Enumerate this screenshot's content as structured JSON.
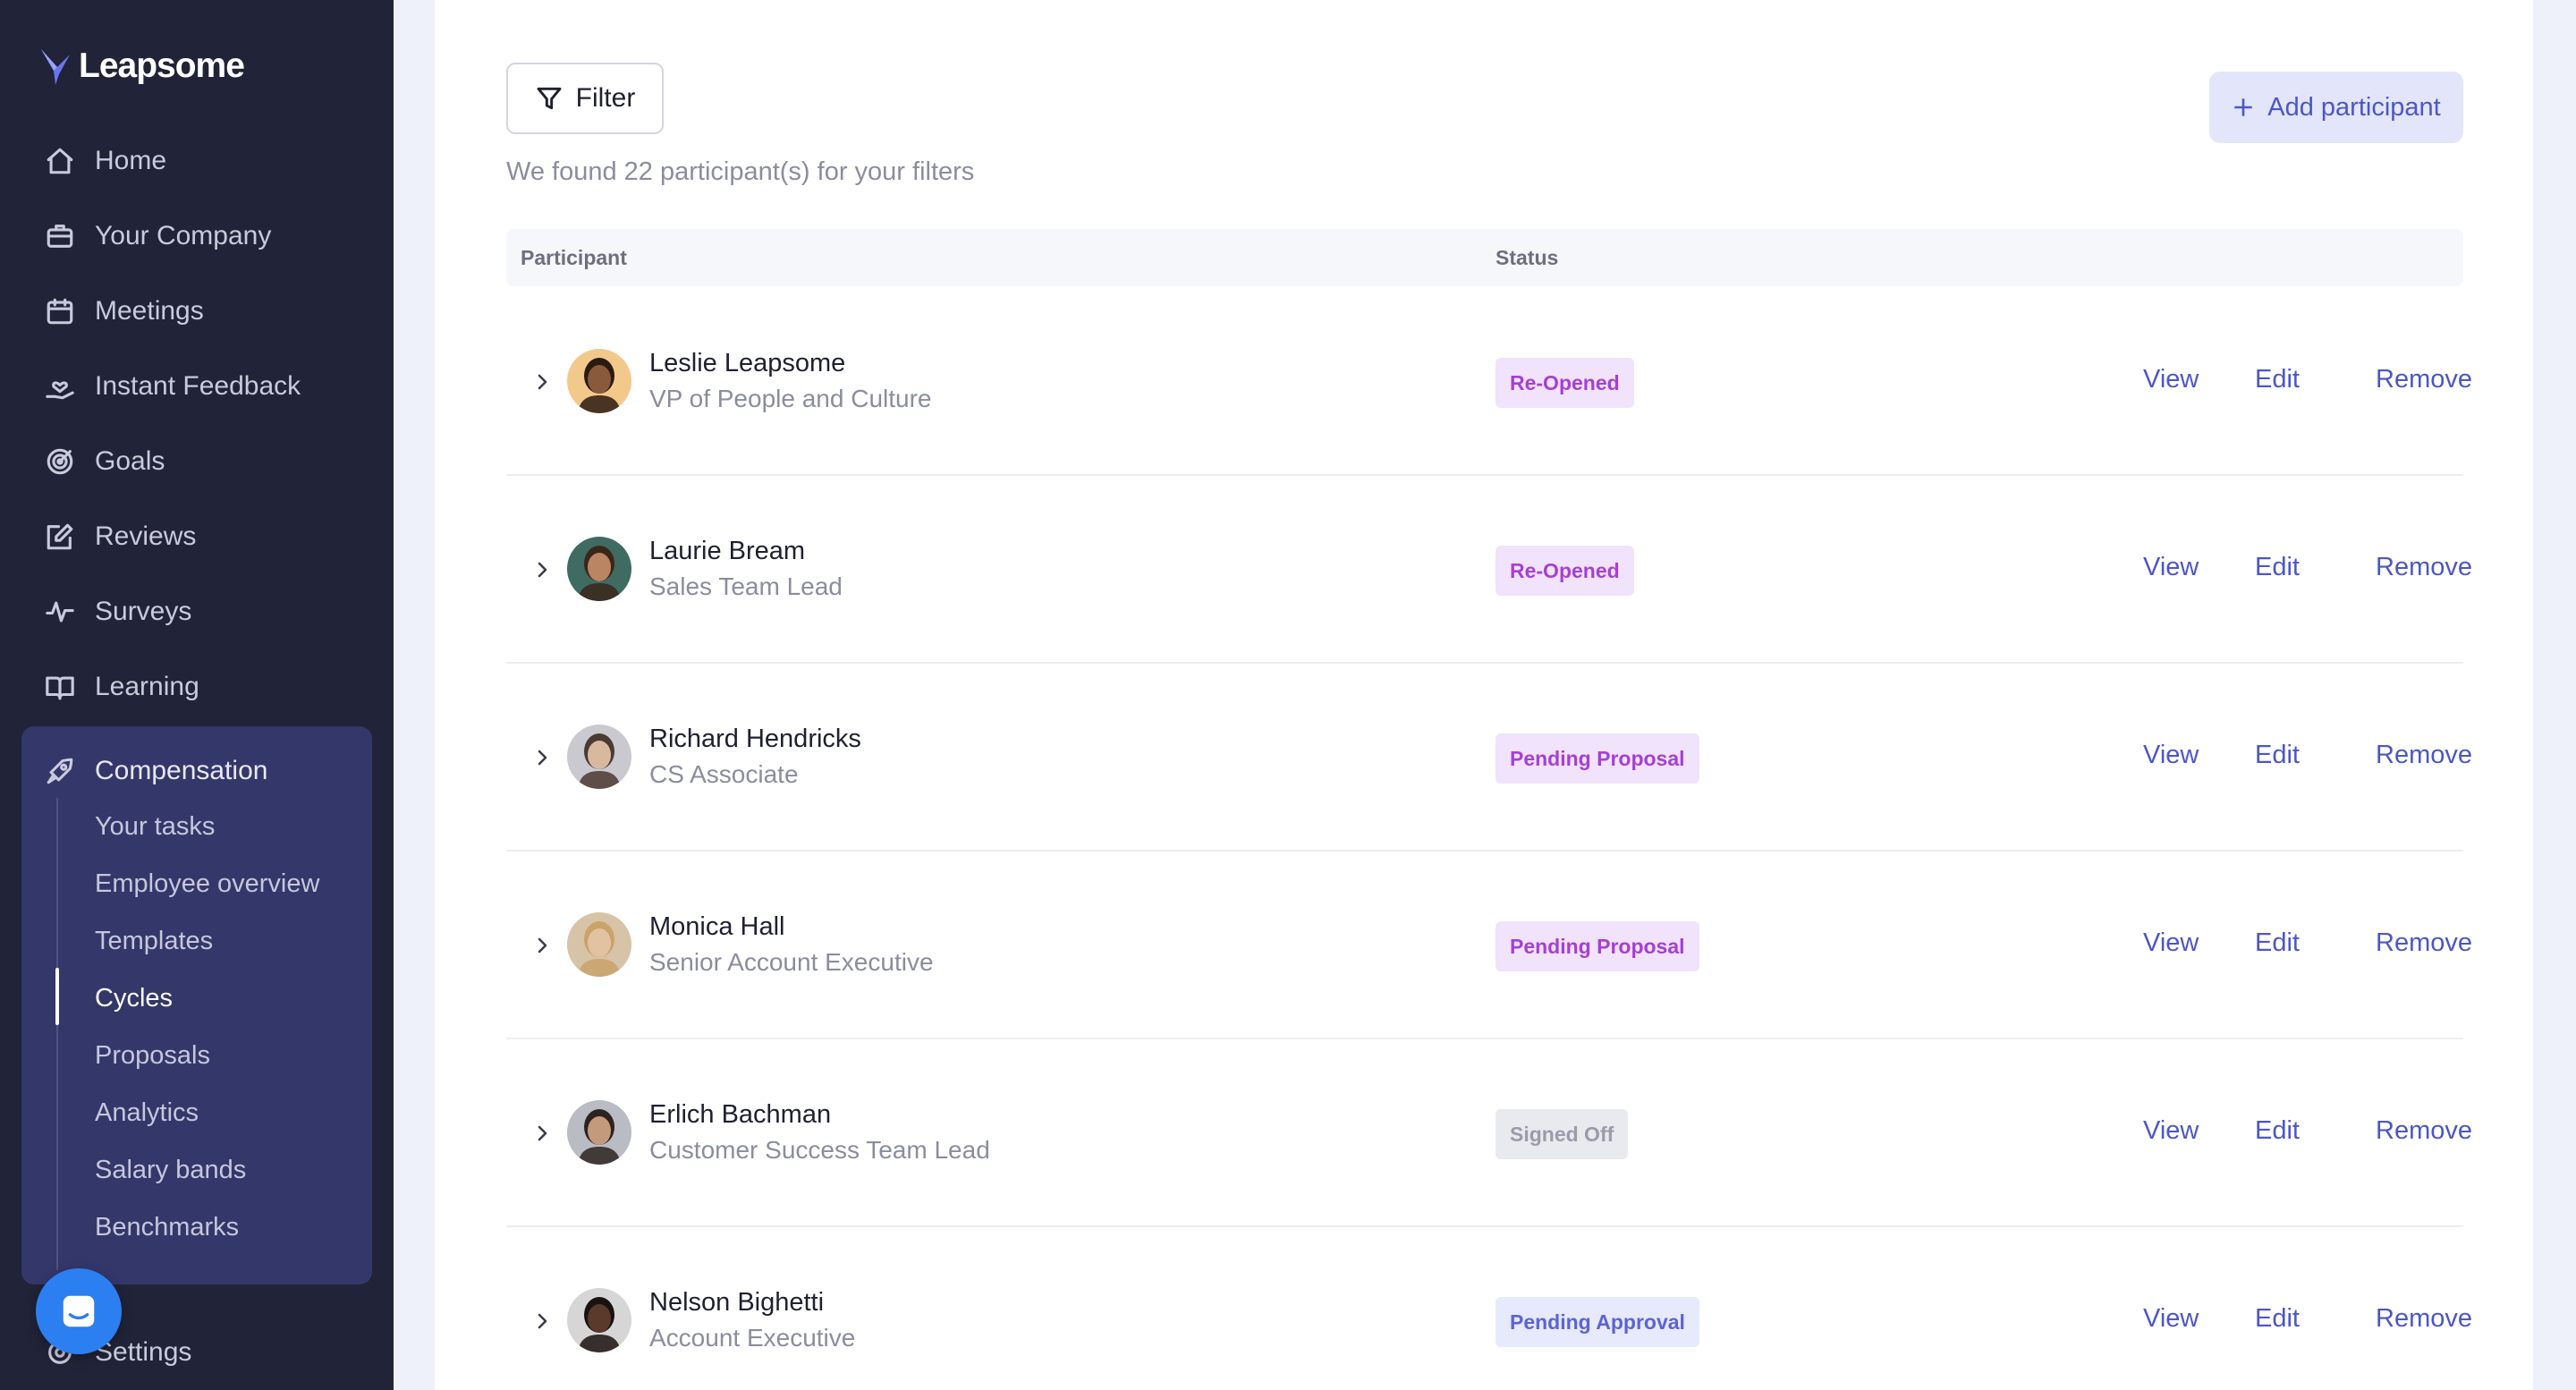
{
  "app": {
    "name": "Leapsome"
  },
  "sidebar": {
    "items": [
      {
        "label": "Home",
        "icon": "home-icon"
      },
      {
        "label": "Your Company",
        "icon": "briefcase-icon"
      },
      {
        "label": "Meetings",
        "icon": "calendar-icon"
      },
      {
        "label": "Instant Feedback",
        "icon": "hand-heart-icon"
      },
      {
        "label": "Goals",
        "icon": "target-icon"
      },
      {
        "label": "Reviews",
        "icon": "edit-icon"
      },
      {
        "label": "Surveys",
        "icon": "pulse-icon"
      },
      {
        "label": "Learning",
        "icon": "book-icon"
      }
    ],
    "compensation": {
      "label": "Compensation",
      "icon": "rocket-icon",
      "subitems": [
        {
          "label": "Your tasks"
        },
        {
          "label": "Employee overview"
        },
        {
          "label": "Templates"
        },
        {
          "label": "Cycles",
          "active": true
        },
        {
          "label": "Proposals"
        },
        {
          "label": "Analytics"
        },
        {
          "label": "Salary bands"
        },
        {
          "label": "Benchmarks"
        }
      ]
    },
    "settings": {
      "label": "Settings",
      "icon": "gear-icon"
    }
  },
  "toolbar": {
    "filter_label": "Filter",
    "add_label": "Add participant"
  },
  "results": {
    "text": "We found 22 participant(s) for your filters"
  },
  "table": {
    "headers": {
      "participant": "Participant",
      "status": "Status"
    },
    "actions": {
      "view": "View",
      "edit": "Edit",
      "remove": "Remove"
    },
    "rows": [
      {
        "name": "Leslie Leapsome",
        "title": "VP of People and Culture",
        "status": "Re-Opened",
        "status_type": "reopened"
      },
      {
        "name": "Laurie Bream",
        "title": "Sales Team Lead",
        "status": "Re-Opened",
        "status_type": "reopened"
      },
      {
        "name": "Richard Hendricks",
        "title": "CS Associate",
        "status": "Pending Proposal",
        "status_type": "pending-proposal"
      },
      {
        "name": "Monica Hall",
        "title": "Senior Account Executive",
        "status": "Pending Proposal",
        "status_type": "pending-proposal"
      },
      {
        "name": "Erlich Bachman",
        "title": "Customer Success Team Lead",
        "status": "Signed Off",
        "status_type": "signed-off"
      },
      {
        "name": "Nelson Bighetti",
        "title": "Account Executive",
        "status": "Pending Approval",
        "status_type": "pending-approval"
      }
    ]
  },
  "colors": {
    "sidebar_bg": "#212338",
    "sidebar_active_bg": "#34376a",
    "accent": "#4c56c8",
    "badge_purple": "#a63fd6",
    "chat_button": "#2b7ff0"
  }
}
